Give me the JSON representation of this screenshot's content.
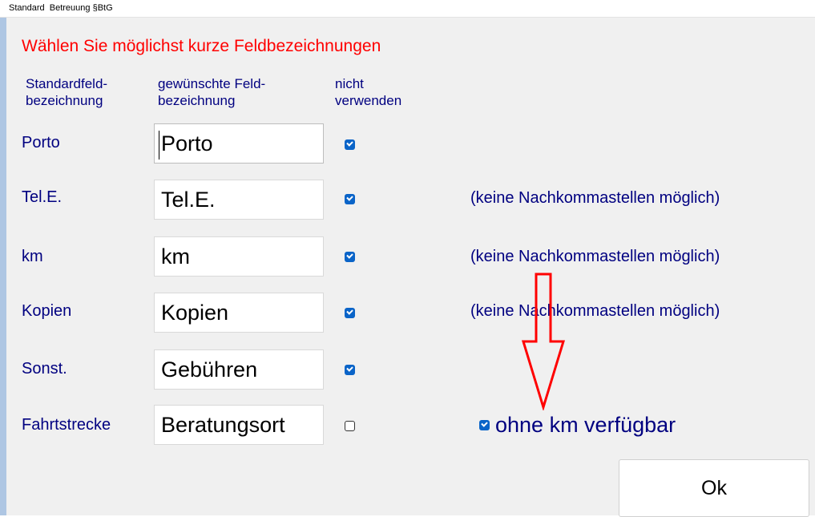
{
  "window": {
    "title": "Standard  Betreuung §BtG"
  },
  "heading": "Wählen Sie möglichst kurze Feldbezeichnungen",
  "columns": {
    "standard": [
      "Standardfeld-",
      "bezeichnung"
    ],
    "desired": [
      "gewünschte Feld-",
      "bezeichnung"
    ],
    "unused": [
      "nicht",
      "verwenden"
    ]
  },
  "rows": [
    {
      "label": "Porto",
      "value": "Porto",
      "not_used": true,
      "note": ""
    },
    {
      "label": "Tel.E.",
      "value": "Tel.E.",
      "not_used": true,
      "note": "(keine Nachkommastellen möglich)"
    },
    {
      "label": "km",
      "value": "km",
      "not_used": true,
      "note": "(keine Nachkommastellen möglich)"
    },
    {
      "label": "Kopien",
      "value": "Kopien",
      "not_used": true,
      "note": "(keine Nachkommastellen möglich)"
    },
    {
      "label": "Sonst.",
      "value": "Gebühren",
      "not_used": true,
      "note": ""
    },
    {
      "label": "Fahrtstrecke",
      "value": "Beratungsort",
      "not_used": false,
      "note": ""
    }
  ],
  "option": {
    "label": "ohne km verfügbar",
    "checked": true
  },
  "ok_button": "Ok",
  "colors": {
    "label": "#000080",
    "heading": "#ff0000",
    "checkbox": "#0a64c8",
    "annotation_arrow": "#ff0000"
  },
  "annotation": {
    "icon": "down-arrow-icon"
  }
}
